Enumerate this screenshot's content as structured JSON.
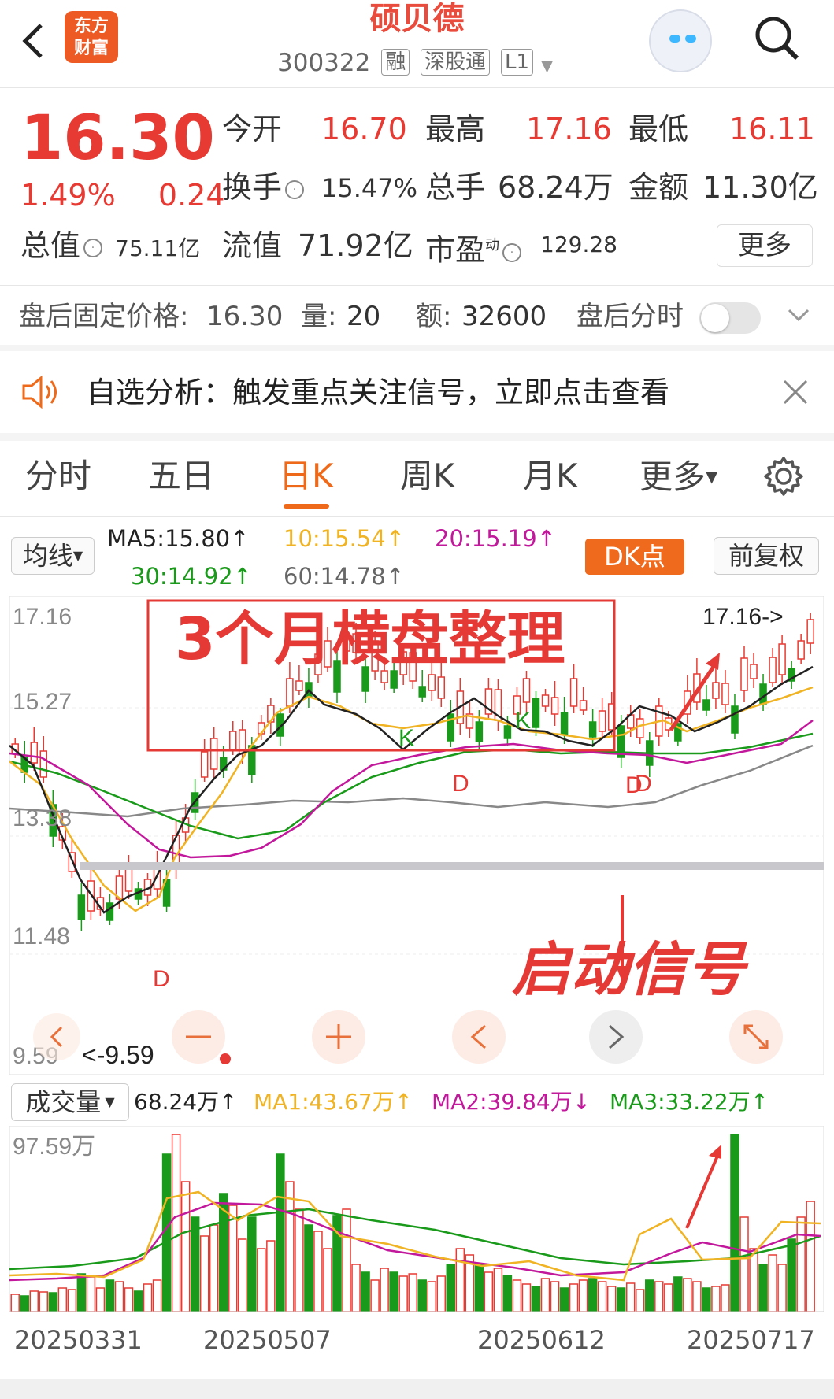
{
  "header": {
    "logo_line1": "东方",
    "logo_line2": "财富",
    "stock_name": "硕贝德",
    "stock_code": "300322",
    "tags": [
      "融",
      "深股通",
      "L1"
    ]
  },
  "quote": {
    "price": "16.30",
    "change_pct": "1.49%",
    "change_amt": "0.24",
    "open_label": "今开",
    "open": "16.70",
    "high_label": "最高",
    "high": "17.16",
    "low_label": "最低",
    "low": "16.11",
    "turnover_label": "换手",
    "turnover": "15.47%",
    "volume_label": "总手",
    "volume": "68.24万",
    "amount_label": "金额",
    "amount": "11.30亿",
    "mktcap_label": "总值",
    "mktcap": "75.11亿",
    "float_label": "流值",
    "float_cap": "71.92亿",
    "pe_label": "市盈",
    "pe_sup": "动",
    "pe": "129.28",
    "more_label": "更多"
  },
  "after_hours": {
    "price_label": "盘后固定价格:",
    "price": "16.30",
    "vol_label": "量:",
    "vol": "20",
    "amt_label": "额:",
    "amt": "32600",
    "timeshare_label": "盘后分时"
  },
  "notice": {
    "text": "自选分析：触发重点关注信号，立即点击查看"
  },
  "tabs": [
    "分时",
    "五日",
    "日K",
    "周K",
    "月K",
    "更多"
  ],
  "active_tab": "日K",
  "ma_bar": {
    "selector": "均线",
    "ma5": "MA5:15.80↑",
    "ma10": "10:15.54↑",
    "ma20": "20:15.19↑",
    "ma30": "30:14.92↑",
    "ma60": "60:14.78↑",
    "dk_label": "DK点",
    "adjust_label": "前复权"
  },
  "colors": {
    "up": "#e63a33",
    "down": "#1a9a1a",
    "ma5": "#222222",
    "ma10": "#f0b323",
    "ma20": "#c2189b",
    "ma30": "#1a9a1a",
    "ma60": "#888888",
    "accent": "#ee6a1a"
  },
  "annotations": {
    "consolidation": "3个月横盘整理",
    "start_signal": "启动信号",
    "high_marker": "17.16->",
    "low_marker": "<-9.59"
  },
  "chart_data": [
    {
      "type": "candlestick",
      "y_ticks": [
        "17.16",
        "15.27",
        "13.38",
        "11.48",
        "9.59"
      ],
      "ylim": [
        9.59,
        17.16
      ],
      "x_ticks": [
        "20250331",
        "20250507",
        "20250612",
        "20250717"
      ],
      "signal_marks": [
        "D",
        "D",
        "K",
        "D",
        "K",
        "D"
      ],
      "high": 17.16,
      "low": 9.59
    },
    {
      "type": "bar",
      "title": "成交量",
      "value": "68.24万↑",
      "ma1": "MA1:43.67万↑",
      "ma2": "MA2:39.84万↓",
      "ma3": "MA3:33.22万↑",
      "y_ticks": [
        "97.59万"
      ],
      "ylim": [
        0,
        97.59
      ]
    }
  ]
}
